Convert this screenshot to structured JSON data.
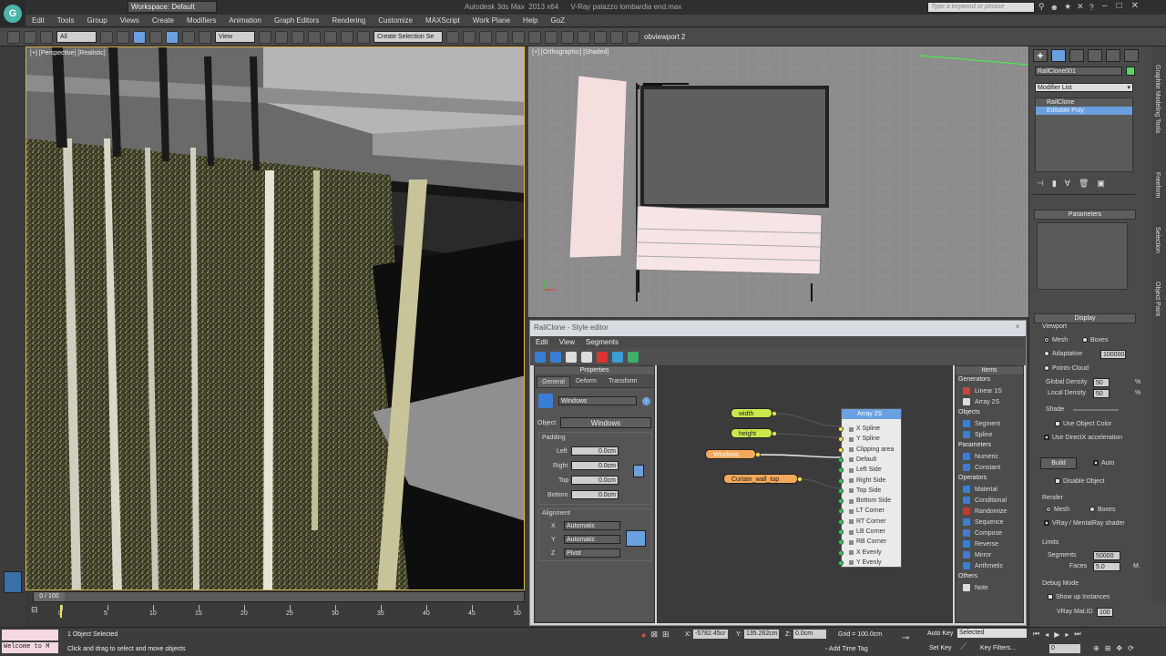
{
  "titlebar": {
    "workspace": "Workspace: Default",
    "app_title": "Autodesk 3ds Max  2013 x64      V-Ray palazzo lombardia end.max",
    "search_placeholder": "Type a keyword or phrase"
  },
  "menu": [
    "Edit",
    "Tools",
    "Group",
    "Views",
    "Create",
    "Modifiers",
    "Animation",
    "Graph Editors",
    "Rendering",
    "Customize",
    "MAXScript",
    "Work Plane",
    "Help",
    "GoZ"
  ],
  "toolbar": {
    "filter": "All",
    "view": "View",
    "selection_set": "Create Selection Se",
    "viewport_name": "obviewport 2"
  },
  "viewports": {
    "perspective_label": "[+] [Perspective] [Realistic]",
    "ortho_label": "[+] [Orthographic] [Shaded]"
  },
  "command_panel": {
    "object_name": "RailClone001",
    "modifier_list_label": "Modifier List",
    "stack": [
      "RailClone",
      "Editable Poly"
    ],
    "parameters_rollout": "Parameters",
    "display_rollout": "Display",
    "viewport_label": "Viewport",
    "mesh": "Mesh",
    "boxes": "Boxes",
    "adaptative": "Adaptative",
    "adaptative_value": "100000",
    "points_cloud": "Points-Cloud",
    "global_density": "Global Density",
    "global_density_value": "50",
    "local_density": "Local Density",
    "local_density_value": "50",
    "pct": "%",
    "shade": "Shade",
    "use_object_color": "Use Object Color",
    "use_directx": "Use DirectX acceleration",
    "build": "Build",
    "auto": "Auto",
    "disable_object": "Disable Object",
    "render_label": "Render",
    "render_mesh": "Mesh",
    "render_boxes": "Boxes",
    "vray_shader": "VRay / MentalRay shader",
    "limits_label": "Limits",
    "segments": "Segments",
    "segments_value": "50000",
    "faces": "Faces",
    "faces_value": "5.0",
    "faces_unit": "M.",
    "debug_label": "Debug Mode",
    "show_instances": "Show up Instances",
    "vray_mat_id": "VRay Mat.ID",
    "vray_mat_id_value": "100"
  },
  "right_tabs": [
    "Graphite Modeling Tools",
    "Freeform",
    "Selection",
    "Object Paint"
  ],
  "editor": {
    "title": "RailClone - Style editor",
    "close": "×",
    "menu": [
      "Edit",
      "View",
      "Segments"
    ],
    "properties_header": "Properties",
    "tabs": [
      "General",
      "Deform",
      "Transform"
    ],
    "object_name": "Windows",
    "object_label": "Object",
    "object_value": "Windows",
    "padding_label": "Padding",
    "padding": [
      {
        "label": "Left",
        "value": "0.0cm"
      },
      {
        "label": "Right",
        "value": "0.0cm"
      },
      {
        "label": "Top",
        "value": "0.0cm"
      },
      {
        "label": "Bottom",
        "value": "0.0cm"
      }
    ],
    "alignment_label": "Alignment",
    "alignment": [
      {
        "axis": "X",
        "value": "Automatic"
      },
      {
        "axis": "Y",
        "value": "Automatic"
      },
      {
        "axis": "Z",
        "value": "Pivot"
      }
    ],
    "nodes": {
      "width": "width",
      "height": "height",
      "windows": "Windows",
      "curtain": "Curtain_wall_top"
    },
    "array_node": {
      "title": "Array 2S",
      "inputs": [
        "X Spline",
        "Y Spline",
        "Clipping area",
        "Default",
        "Left Side",
        "Right Side",
        "Top Side",
        "Bottom Side",
        "LT Corner",
        "RT Corner",
        "LB Corner",
        "RB Corner",
        "X Evenly",
        "Y Evenly"
      ]
    },
    "items_header": "Items",
    "items": [
      {
        "category": "Generators",
        "entries": [
          {
            "name": "Linear 1S",
            "color": "#c44"
          },
          {
            "name": "Array 2S",
            "color": "#ddd"
          }
        ]
      },
      {
        "category": "Objects",
        "entries": [
          {
            "name": "Segment",
            "color": "#3a7fd6"
          },
          {
            "name": "Spline",
            "color": "#3a7fd6"
          }
        ]
      },
      {
        "category": "Parameters",
        "entries": [
          {
            "name": "Numeric",
            "color": "#3a7fd6"
          },
          {
            "name": "Constant",
            "color": "#3a7fd6"
          }
        ]
      },
      {
        "category": "Operators",
        "entries": [
          {
            "name": "Material",
            "color": "#3a7fd6"
          },
          {
            "name": "Conditional",
            "color": "#3a7fd6"
          },
          {
            "name": "Randomize",
            "color": "#c33"
          },
          {
            "name": "Sequence",
            "color": "#3a7fd6"
          },
          {
            "name": "Compose",
            "color": "#3a7fd6"
          },
          {
            "name": "Reverse",
            "color": "#3a7fd6"
          },
          {
            "name": "Mirror",
            "color": "#3a7fd6"
          },
          {
            "name": "Arithmetic",
            "color": "#3a7fd6"
          }
        ]
      },
      {
        "category": "Others",
        "entries": [
          {
            "name": "Note",
            "color": "#ddd"
          }
        ]
      }
    ]
  },
  "timeline": {
    "frame": "0 / 100",
    "ticks": [
      "0",
      "5",
      "10",
      "15",
      "20",
      "25",
      "30",
      "35",
      "40",
      "45",
      "50"
    ]
  },
  "status": {
    "welcome": "Welcome to M",
    "selected": "1 Object Selected",
    "prompt": "Click and drag to select and move objects",
    "x_label": "X:",
    "x_value": "-5782.45cr",
    "y_label": "Y:",
    "y_value": "135.262cm",
    "z_label": "Z:",
    "z_value": "0.0cm",
    "grid": "Grid = 100.0cm",
    "add_time_tag": "Add Time Tag",
    "auto_key": "Auto Key",
    "key_mode": "Selected",
    "set_key": "Set Key",
    "key_filters": "Key Filters...",
    "frame_field": "0"
  },
  "colors": {
    "accent_blue": "#6aa0e0",
    "node_yellow": "#c9e84a",
    "node_orange": "#f5a85a",
    "viewport_border": "#d9b84a"
  }
}
